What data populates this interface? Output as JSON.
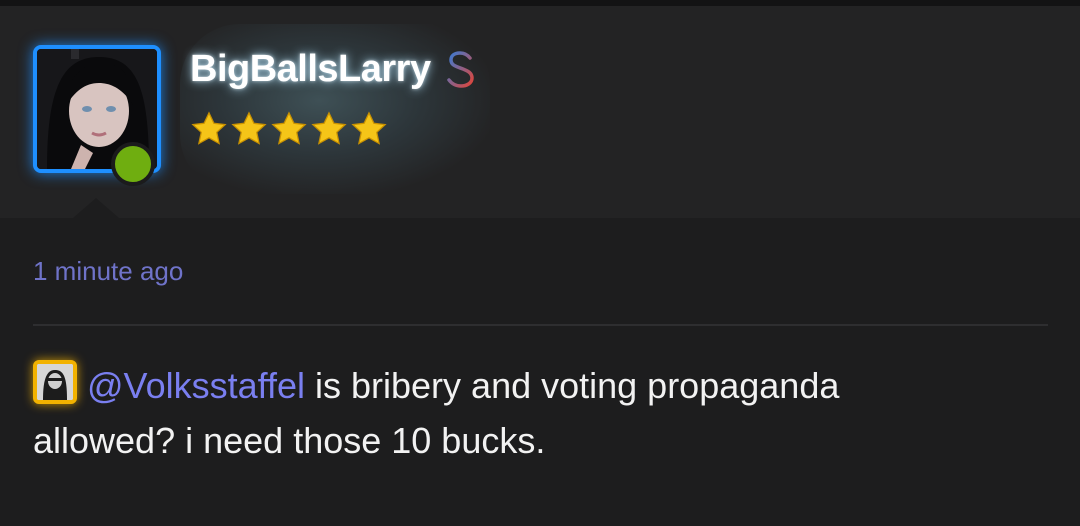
{
  "user": {
    "name": "BigBallsLarry",
    "rating_stars": 5,
    "online": true,
    "badge_icon": "dollar-icon"
  },
  "post": {
    "timestamp": "1 minute ago",
    "mention": "@Volksstaffel",
    "text_line1": " is bribery and voting propaganda",
    "text_line2": "allowed? i need those 10 bucks."
  },
  "colors": {
    "background": "#1d1d1e",
    "header_background": "#232324",
    "avatar_border": "#1e8fff",
    "online_status": "#6fae10",
    "star": "#f5c518",
    "timestamp": "#6f73c9",
    "mention": "#7a7ff0",
    "mini_avatar_border": "#f2b200"
  }
}
